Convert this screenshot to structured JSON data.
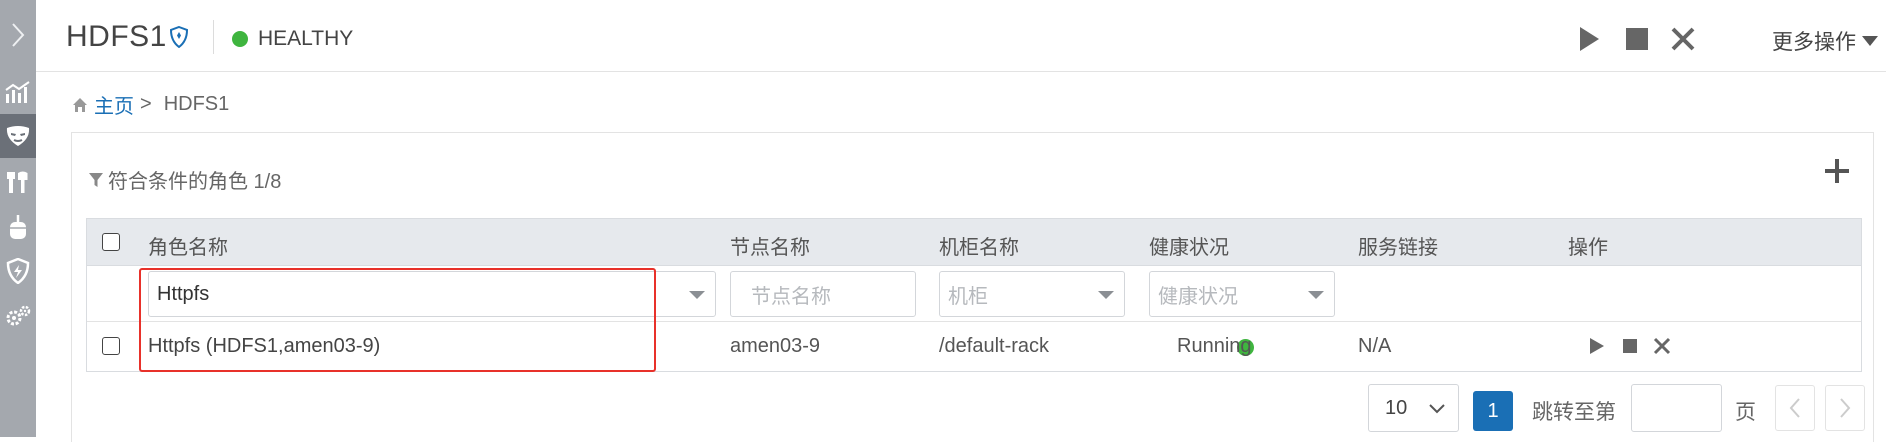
{
  "sidebar": {
    "toggle_icon": "chevron-right-icon",
    "items": [
      {
        "icon": "chart-icon"
      },
      {
        "icon": "mask-icon",
        "active": true
      },
      {
        "icon": "tools-icon"
      },
      {
        "icon": "mouse-icon"
      },
      {
        "icon": "shield-icon"
      },
      {
        "icon": "gears-icon"
      }
    ]
  },
  "header": {
    "service_name": "HDFS1",
    "status": "HEALTHY",
    "status_color": "#3fb53f",
    "more_actions": "更多操作"
  },
  "breadcrumb": {
    "home": "主页",
    "separator": ">",
    "current": "HDFS1"
  },
  "panel": {
    "filter_title": "符合条件的角色 1/8"
  },
  "table": {
    "columns": [
      "角色名称",
      "节点名称",
      "机柜名称",
      "健康状况",
      "服务链接",
      "操作"
    ],
    "filters": {
      "role_value": "Httpfs",
      "node_placeholder": "节点名称",
      "rack_placeholder": "机柜",
      "health_placeholder": "健康状况"
    },
    "rows": [
      {
        "role": "Httpfs (HDFS1,amen03-9)",
        "node": "amen03-9",
        "rack": "/default-rack",
        "health": "Running",
        "link": "N/A"
      }
    ]
  },
  "pagination": {
    "page_size": "10",
    "current_page": "1",
    "jump_label": "跳转至第",
    "page_suffix": "页",
    "accent_color": "#1a6fb5"
  }
}
